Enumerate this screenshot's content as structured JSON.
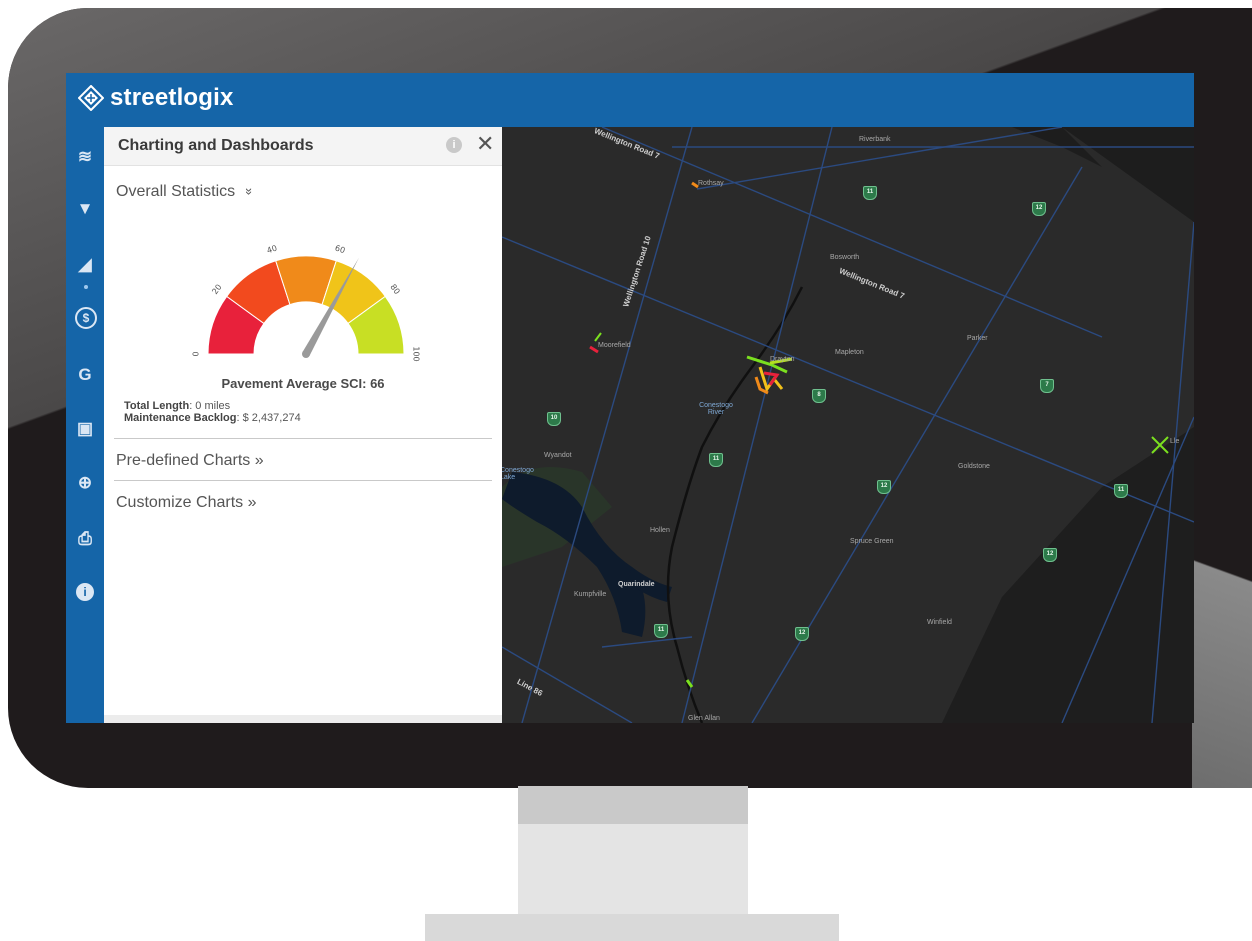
{
  "app": {
    "brand": "streetlogix"
  },
  "sidebar": {
    "items": [
      {
        "name": "layers",
        "glyph": "≋"
      },
      {
        "name": "filter",
        "glyph": "▼"
      },
      {
        "name": "charts",
        "glyph": "◢"
      },
      {
        "name": "budget",
        "glyph": "$"
      },
      {
        "name": "google",
        "glyph": "G"
      },
      {
        "name": "inventory",
        "glyph": "▣"
      },
      {
        "name": "network",
        "glyph": "⊕"
      },
      {
        "name": "print",
        "glyph": "⎙"
      },
      {
        "name": "info",
        "glyph": "i"
      }
    ]
  },
  "panel": {
    "title": "Charting and Dashboards",
    "info_glyph": "i",
    "close_glyph": "✕",
    "overall_statistics": "Overall Statistics",
    "overall_chevron": "»",
    "gauge": {
      "value": 66,
      "min": 0,
      "max": 100,
      "ticks": [
        "0",
        "20",
        "40",
        "60",
        "80",
        "100"
      ],
      "band_colors": [
        "#e8213b",
        "#f24a1e",
        "#f08a1a",
        "#f0c419",
        "#c8df24"
      ],
      "needle_color": "#9a9a9a"
    },
    "gauge_label": "Pavement Average SCI: 66",
    "total_length_label": "Total Length",
    "total_length_value": ": 0 miles",
    "backlog_label": "Maintenance Backlog",
    "backlog_value": ": $ 2,437,274",
    "predefined_charts": "Pre-defined Charts »",
    "customize_charts": "Customize Charts »"
  },
  "map": {
    "roads": [
      "Wellington Road 7",
      "Wellington Road 10",
      "Wellington Road 7",
      "Line 86"
    ],
    "places": [
      "Riverbank",
      "Rothsay",
      "Bosworth",
      "Moorefield",
      "Drayton",
      "Mapleton",
      "Parker",
      "Wyandot",
      "Goldstone",
      "Hollen",
      "Spruce Green",
      "Quarindale",
      "Kumpfville",
      "Winfield",
      "Glen Allan",
      "Lle"
    ],
    "water": [
      "Conestogo River",
      "Conestogo Lake"
    ],
    "shields": [
      "11",
      "12",
      "10",
      "8",
      "7",
      "11",
      "12",
      "11",
      "12",
      "12",
      "11"
    ]
  }
}
